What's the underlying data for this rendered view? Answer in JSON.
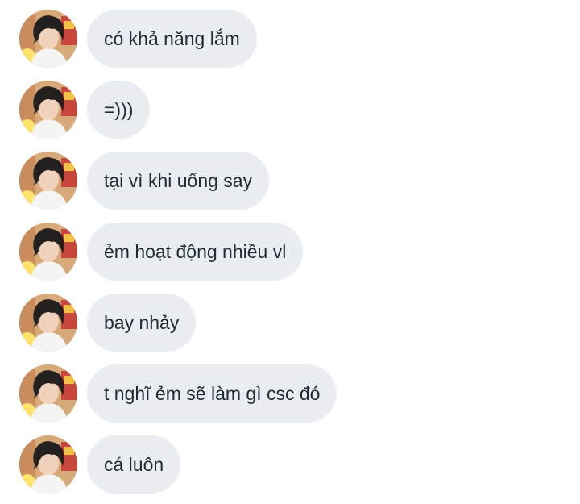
{
  "messages": [
    {
      "text": "có khả năng lắm"
    },
    {
      "text": "=)))"
    },
    {
      "text": "tại vì khi uống say"
    },
    {
      "text": "ẻm hoạt động nhiều vl"
    },
    {
      "text": "bay nhảy"
    },
    {
      "text": "t nghĩ ẻm sẽ làm gì csc đó"
    },
    {
      "text": "cá luôn"
    }
  ],
  "colors": {
    "bubble_bg": "#e9edf1",
    "bubble_text": "#1f2a33",
    "page_bg": "#ffffff"
  }
}
